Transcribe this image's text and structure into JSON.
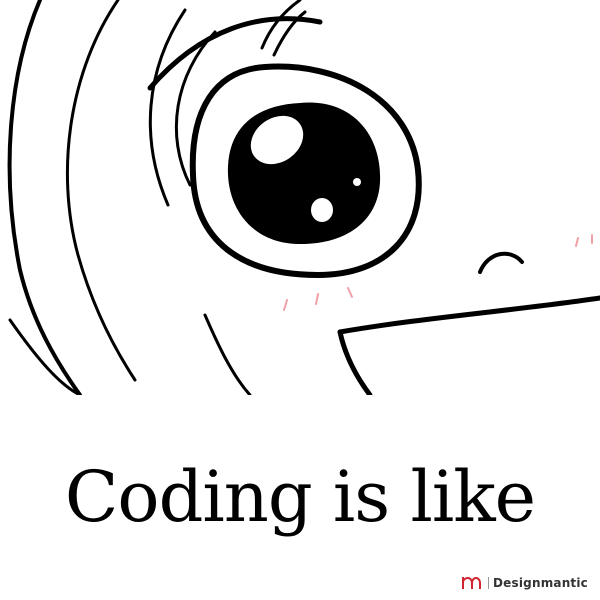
{
  "caption": {
    "text": "Coding is like"
  },
  "brand": {
    "name": "Designmantic",
    "logo_icon": "dm-logo-icon",
    "accent_color": "#d0262f"
  },
  "illustration": {
    "subject": "cartoon-creature-eye",
    "blush_color": "#f0a0a6"
  }
}
